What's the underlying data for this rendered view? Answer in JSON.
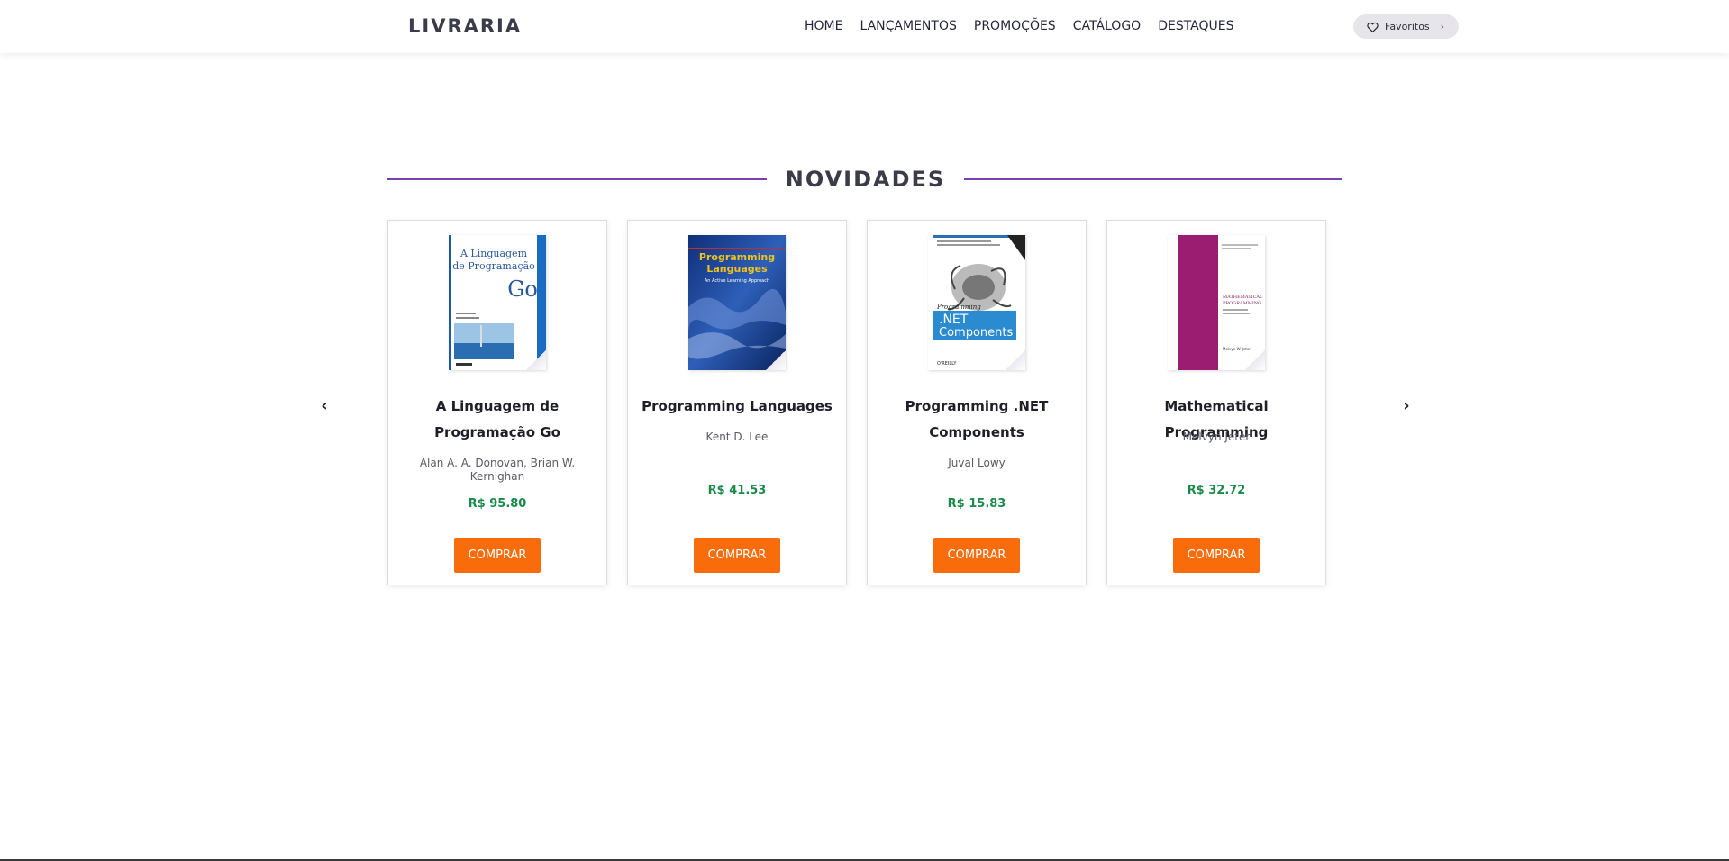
{
  "header": {
    "logo": "LIVRARIA",
    "nav": [
      "HOME",
      "LANÇAMENTOS",
      "PROMOÇÕES",
      "CATÁLOGO",
      "DESTAQUES"
    ],
    "favorites_label": "Favoritos",
    "favorites_icon": "heart-icon",
    "favorites_chevron": "›"
  },
  "section": {
    "title": "NOVIDADES",
    "accent_color": "#7a3fb0",
    "prev_arrow": "‹",
    "next_arrow": "›"
  },
  "books": [
    {
      "title": "A Linguagem de Programação Go",
      "author": "Alan A. A. Donovan, Brian W. Kernighan",
      "price": "R$ 95.80",
      "button": "COMPRAR",
      "cover_text": [
        "A Linguagem",
        "de Programação",
        "Go"
      ]
    },
    {
      "title": "Programming Languages",
      "author": "Kent D. Lee",
      "price": "R$ 41.53",
      "button": "COMPRAR",
      "cover_text": [
        "Programming",
        "Languages",
        "An Active Learning Approach"
      ]
    },
    {
      "title": "Programming .NET Components",
      "author": "Juval Lowy",
      "price": "R$ 15.83",
      "button": "COMPRAR",
      "cover_text": [
        "Programming",
        ".NET",
        "Components",
        "O'REILLY"
      ]
    },
    {
      "title": "Mathematical Programming",
      "author": "Melvyn Jeter",
      "price": "R$ 32.72",
      "button": "COMPRAR",
      "cover_text": [
        "MATHEMATICAL",
        "PROGRAMMING",
        "Melvyn W. Jeter"
      ]
    }
  ],
  "colors": {
    "price": "#1a8a4a",
    "button": "#f86c0b"
  }
}
